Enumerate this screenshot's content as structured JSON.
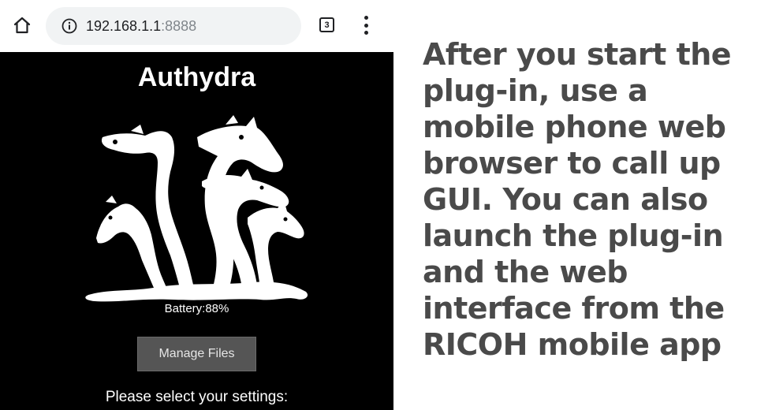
{
  "browser": {
    "url_host": "192.168.1.1",
    "url_port": ":8888",
    "tab_count": "3",
    "icons": {
      "home": "home-icon",
      "info": "info-icon",
      "tabs": "tab-switcher-icon",
      "menu": "more-vert-icon"
    }
  },
  "page": {
    "title": "Authydra",
    "logo": "hydra-logo",
    "battery": "Battery:88%",
    "manage_button": "Manage Files",
    "settings_prompt": "Please select your settings:"
  },
  "caption": "After you start the plug-in, use a mobile phone web browser to call up GUI.  You can also launch the plug-in and the web interface from the RICOH mobile app",
  "colors": {
    "page_background": "#000000",
    "caption_text": "#4a4a4a",
    "button_background": "#555555",
    "url_bar_background": "#f1f3f4"
  }
}
